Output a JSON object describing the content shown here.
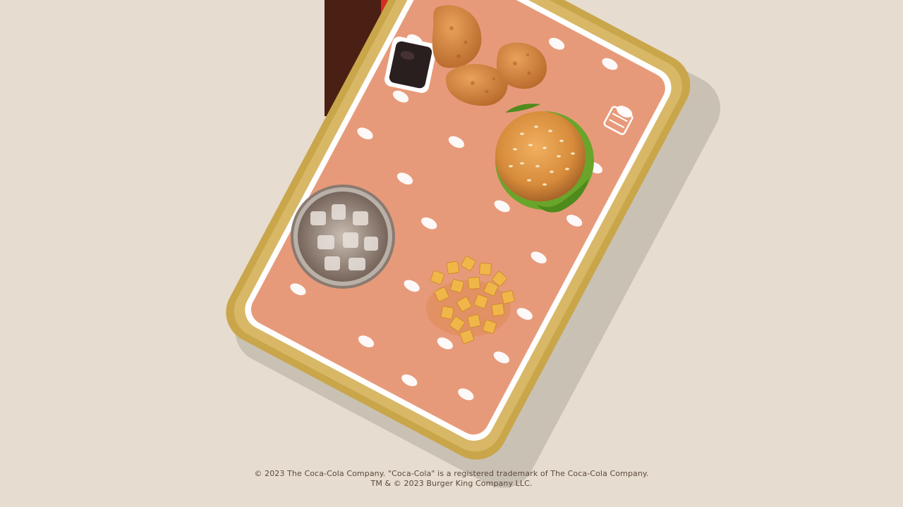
{
  "colors": {
    "background": "#e6dccf",
    "tray_rim": "#c9a64a",
    "tray_liner": "#e79a7a",
    "liner_dots": "#ffffff",
    "bun": "#d68b3a",
    "lettuce": "#6aa52b",
    "nuggets": "#c87a34",
    "fries": "#f0b64a",
    "cola": "#8a7a70",
    "sauce": "#2a1f1f",
    "brand_stripe": "#4a1f14",
    "brand_accent": "#d62b1e"
  },
  "scene": {
    "description_items": [
      "food-tray",
      "burger",
      "chicken-nuggets",
      "dipping-sauce",
      "french-fries",
      "cola-with-ice"
    ]
  },
  "legal": {
    "line1": "© 2023 The Coca-Cola Company. \"Coca-Cola\" is a registered trademark of The Coca-Cola Company.",
    "line2": "TM & © 2023 Burger King Company LLC."
  }
}
